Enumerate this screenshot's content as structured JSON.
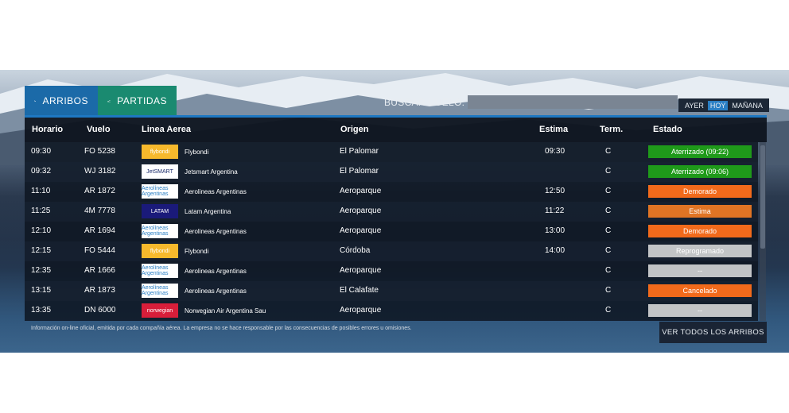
{
  "tabs": {
    "arrivals": "ARRIBOS",
    "departures": "PARTIDAS"
  },
  "search": {
    "label": "BUSCAR VUELO:",
    "value": ""
  },
  "days": [
    "AYER",
    "HOY",
    "MAÑANA"
  ],
  "active_day": "HOY",
  "columns": {
    "time": "Horario",
    "flight": "Vuelo",
    "airline": "Linea Aerea",
    "origin": "Origen",
    "estimate": "Estima",
    "terminal": "Term.",
    "status": "Estado"
  },
  "flights": [
    {
      "time": "09:30",
      "flight": "FO 5238",
      "logo": "flybondi",
      "airline": "Flybondi",
      "origin": "El Palomar",
      "estimate": "09:30",
      "terminal": "C",
      "status": "Aterrizado (09:22)",
      "status_color": "#1f9a1a"
    },
    {
      "time": "09:32",
      "flight": "WJ 3182",
      "logo": "JetSMART",
      "airline": "Jetsmart Argentina",
      "origin": "El Palomar",
      "estimate": "",
      "terminal": "C",
      "status": "Aterrizado (09:06)",
      "status_color": "#1f9a1a"
    },
    {
      "time": "11:10",
      "flight": "AR 1872",
      "logo": "Aerolíneas Argentinas",
      "airline": "Aerolineas Argentinas",
      "origin": "Aeroparque",
      "estimate": "12:50",
      "terminal": "C",
      "status": "Demorado",
      "status_color": "#f26a1b"
    },
    {
      "time": "11:25",
      "flight": "4M 7778",
      "logo": "LATAM",
      "airline": "Latam Argentina",
      "origin": "Aeroparque",
      "estimate": "11:22",
      "terminal": "C",
      "status": "Estima",
      "status_color": "#e07424"
    },
    {
      "time": "12:10",
      "flight": "AR 1694",
      "logo": "Aerolíneas Argentinas",
      "airline": "Aerolineas Argentinas",
      "origin": "Aeroparque",
      "estimate": "13:00",
      "terminal": "C",
      "status": "Demorado",
      "status_color": "#f26a1b"
    },
    {
      "time": "12:15",
      "flight": "FO 5444",
      "logo": "flybondi",
      "airline": "Flybondi",
      "origin": "Córdoba",
      "estimate": "14:00",
      "terminal": "C",
      "status": "Reprogramado",
      "status_color": "#c2c4c6"
    },
    {
      "time": "12:35",
      "flight": "AR 1666",
      "logo": "Aerolíneas Argentinas",
      "airline": "Aerolineas Argentinas",
      "origin": "Aeroparque",
      "estimate": "",
      "terminal": "C",
      "status": "--",
      "status_color": "#c2c4c6"
    },
    {
      "time": "13:15",
      "flight": "AR 1873",
      "logo": "Aerolíneas Argentinas",
      "airline": "Aerolineas Argentinas",
      "origin": "El Calafate",
      "estimate": "",
      "terminal": "C",
      "status": "Cancelado",
      "status_color": "#f26a1b"
    },
    {
      "time": "13:35",
      "flight": "DN 6000",
      "logo": "norwegian",
      "airline": "Norwegian Air Argentina Sau",
      "origin": "Aeroparque",
      "estimate": "",
      "terminal": "C",
      "status": "--",
      "status_color": "#c2c4c6"
    }
  ],
  "logo_styles": {
    "flybondi": {
      "bg": "#f7b92c",
      "color": "#ffffff"
    },
    "JetSMART": {
      "bg": "#ffffff",
      "color": "#1a2b6b"
    },
    "Aerolíneas Argentinas": {
      "bg": "#ffffff",
      "color": "#2a7fc4"
    },
    "LATAM": {
      "bg": "#1a1a7a",
      "color": "#ffffff"
    },
    "norwegian": {
      "bg": "#d81e3a",
      "color": "#ffffff"
    }
  },
  "footer_note": "Información on-line oficial, emitida por cada compañía aérea. La empresa no se hace responsable por las consecuencias de posibles errores u omisiones.",
  "view_all": "VER TODOS LOS ARRIBOS"
}
